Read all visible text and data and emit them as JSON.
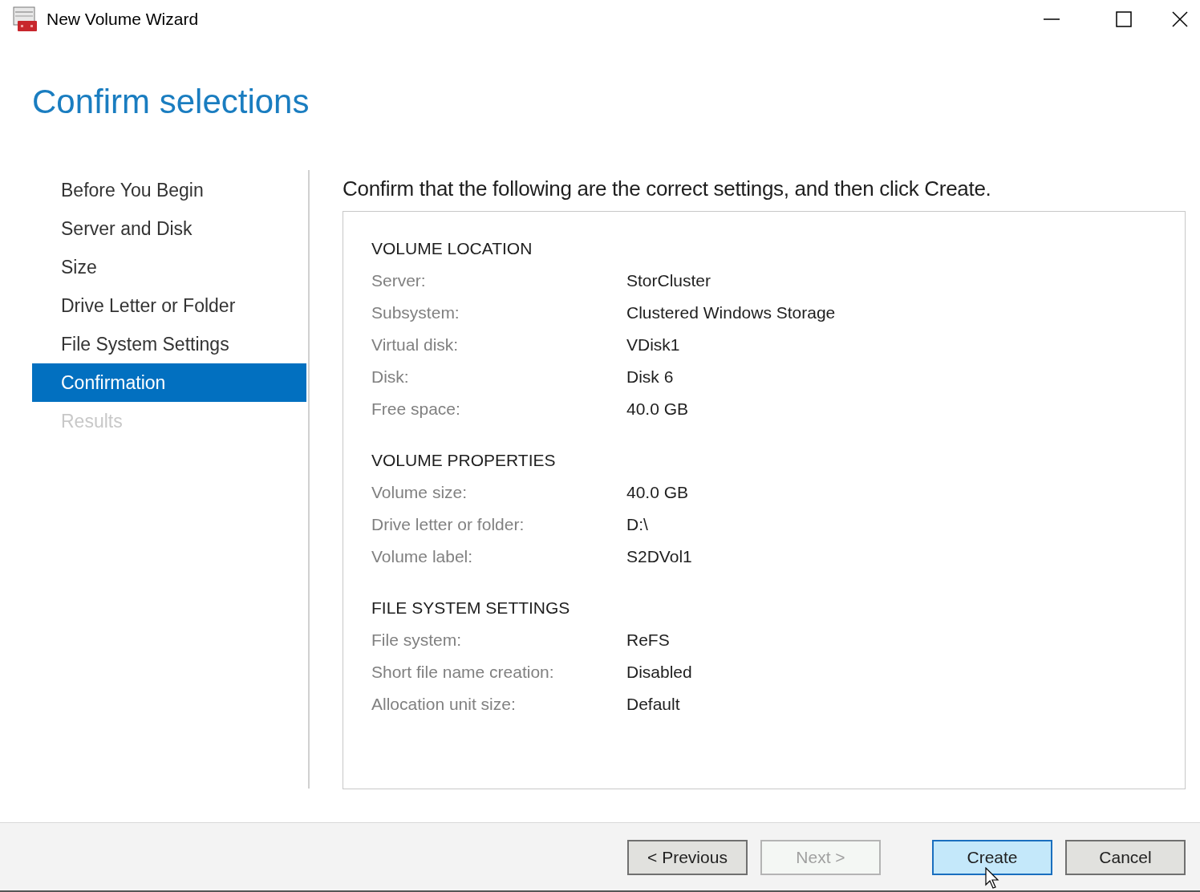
{
  "window": {
    "title": "New Volume Wizard"
  },
  "heading": "Confirm selections",
  "steps": [
    {
      "label": "Before You Begin",
      "selected": false,
      "disabled": false
    },
    {
      "label": "Server and Disk",
      "selected": false,
      "disabled": false
    },
    {
      "label": "Size",
      "selected": false,
      "disabled": false
    },
    {
      "label": "Drive Letter or Folder",
      "selected": false,
      "disabled": false
    },
    {
      "label": "File System Settings",
      "selected": false,
      "disabled": false
    },
    {
      "label": "Confirmation",
      "selected": true,
      "disabled": false
    },
    {
      "label": "Results",
      "selected": false,
      "disabled": true
    }
  ],
  "intro": "Confirm that the following are the correct settings, and then click Create.",
  "sections": [
    {
      "title": "VOLUME LOCATION",
      "rows": [
        {
          "label": "Server:",
          "value": "StorCluster"
        },
        {
          "label": "Subsystem:",
          "value": "Clustered Windows Storage"
        },
        {
          "label": "Virtual disk:",
          "value": "VDisk1"
        },
        {
          "label": "Disk:",
          "value": "Disk 6"
        },
        {
          "label": "Free space:",
          "value": "40.0 GB"
        }
      ]
    },
    {
      "title": "VOLUME PROPERTIES",
      "rows": [
        {
          "label": "Volume size:",
          "value": "40.0 GB"
        },
        {
          "label": "Drive letter or folder:",
          "value": "D:\\"
        },
        {
          "label": "Volume label:",
          "value": "S2DVol1"
        }
      ]
    },
    {
      "title": "FILE SYSTEM SETTINGS",
      "rows": [
        {
          "label": "File system:",
          "value": "ReFS"
        },
        {
          "label": "Short file name creation:",
          "value": "Disabled"
        },
        {
          "label": "Allocation unit size:",
          "value": "Default"
        }
      ]
    }
  ],
  "buttons": [
    {
      "label": "< Previous",
      "disabled": false,
      "focused": false
    },
    {
      "label": "Next >",
      "disabled": true,
      "focused": false
    },
    {
      "label": "Create",
      "disabled": false,
      "focused": true
    },
    {
      "label": "Cancel",
      "disabled": false,
      "focused": false
    }
  ]
}
